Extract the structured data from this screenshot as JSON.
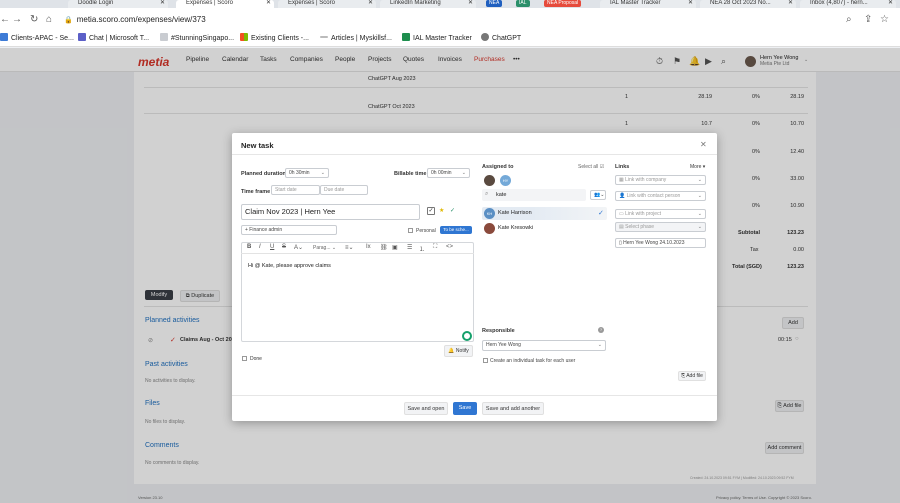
{
  "browser": {
    "tabs": [
      {
        "label": "Doodle Login",
        "active": false
      },
      {
        "label": "Expenses | Scoro",
        "active": true
      },
      {
        "label": "Expenses | Scoro",
        "active": false
      },
      {
        "label": "LinkedIn Marketing",
        "active": false
      },
      {
        "label": "IAL Master Tracker",
        "active": false
      },
      {
        "label": "NEA 28 Oct 2023 No...",
        "active": false
      },
      {
        "label": "Inbox (4,807) - hern...",
        "active": false
      }
    ],
    "pill_1": "NEA",
    "pill_2": "IAL",
    "pill_3": "NEA Proposal",
    "url": "metia.scoro.com/expenses/view/373",
    "bookmarks": [
      "Clients-APAC - Se...",
      "Chat | Microsoft T...",
      "#StunningSingapo...",
      "Existing Clients -...",
      "Articles | Myskillsf...",
      "IAL Master Tracker",
      "ChatGPT"
    ]
  },
  "app": {
    "logo": "metia",
    "nav": [
      "Pipeline",
      "Calendar",
      "Tasks",
      "Companies",
      "People",
      "Projects",
      "Quotes",
      "Invoices",
      "Purchases"
    ],
    "more": "•••",
    "user_name": "Hern Yee Wong",
    "user_company": "Metia Pte Ltd"
  },
  "background": {
    "rows": [
      {
        "desc": "ChatGPT Aug 2023",
        "qty": "1",
        "price": "28.19",
        "vat": "0%",
        "sum": "28.19"
      },
      {
        "desc": "ChatGPT Oct 2023",
        "qty": "1",
        "price": "10.7",
        "vat": "0%",
        "sum": "10.70"
      },
      {
        "desc": "",
        "qty": "1",
        "price": "",
        "vat": "0%",
        "sum": "12.40"
      },
      {
        "desc": "",
        "qty": "1",
        "price": "",
        "vat": "0%",
        "sum": "33.00"
      },
      {
        "desc": "",
        "qty": "1",
        "price": "",
        "vat": "0%",
        "sum": "10.90"
      }
    ],
    "subtotal_label": "Subtotal",
    "subtotal": "123.23",
    "tax_label": "Tax",
    "tax": "0.00",
    "total_label": "Total (SGD)",
    "total": "123.23",
    "modify": "Modify",
    "duplicate": "Duplicate",
    "planned_activities": "Planned activities",
    "add": "Add",
    "activity_title": "Claims Aug - Oct 20...",
    "activity_time": "00:15",
    "past_activities": "Past activities",
    "no_activities": "No activities to display.",
    "files": "Files",
    "add_file": "Add file",
    "no_files": "No files to display.",
    "comments": "Comments",
    "add_comment": "Add comment",
    "no_comments": "No comments to display.",
    "created": "Created: 24.10.2023 09:51 FYM | Modified: 24.10.2023 09:52 FYM",
    "version": "Version 23.10",
    "footer_right": "Privacy policy. Terms of Use. Copyright © 2023 Scoro."
  },
  "modal": {
    "title": "New task",
    "planned_duration_label": "Planned duration",
    "planned_duration_value": "0h 30min",
    "billable_time_label": "Billable time",
    "billable_time_value": "0h 00min",
    "time_frame_label": "Time frame",
    "start_date_placeholder": "Start date",
    "due_date_placeholder": "Due date",
    "task_title": "Claim Nov 2023 | Hern Yee",
    "project_tag": "+ Finance admin",
    "personal_label": "Personal",
    "schedule_btn": "To be sche...",
    "format_label": "Parag...",
    "body_text": "Hi @ Kate, please approve claims",
    "done_label": "Done",
    "notify_label": "Notify",
    "assigned_to_label": "Assigned to",
    "select_all": "Select all",
    "avatar_initials": "HY",
    "search_value": "kate",
    "results": [
      {
        "initials": "KH",
        "name": "Kate Harrison",
        "selected": true
      },
      {
        "initials": "",
        "name": "Kate Kresowki",
        "selected": false
      }
    ],
    "responsible_label": "Responsible",
    "responsible_value": "Hern Yee Wong",
    "individual_task_label": "Create an individual task for each user",
    "links_label": "Links",
    "more_label": "More",
    "link_company": "Link with company",
    "link_contact": "Link with contact person",
    "link_project": "Link with project",
    "select_phase": "Select phase",
    "link_document": "Hern Yee Wong 24.10.2023",
    "add_file": "Add file",
    "save_open": "Save and open",
    "save": "Save",
    "save_add_another": "Save and add another"
  },
  "colors": {
    "accent": "#d8352a",
    "primary": "#2f76d2",
    "link": "#1e6fbf"
  }
}
